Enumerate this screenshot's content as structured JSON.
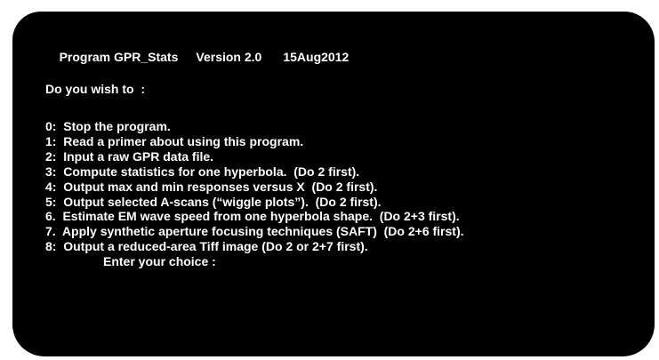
{
  "colors": {
    "background": "#000000",
    "text": "#ffffff",
    "page": "#ffffff"
  },
  "header": {
    "program": "Program GPR_Stats",
    "version": "Version 2.0",
    "date": "15Aug2012"
  },
  "prompt": "Do you wish to  :",
  "menu": {
    "items": [
      "0:  Stop the program.",
      "1:  Read a primer about using this program.",
      "2:  Input a raw GPR data file.",
      "3:  Compute statistics for one hyperbola.  (Do 2 first).",
      "4:  Output max and min responses versus X  (Do 2 first).",
      "5:  Output selected A-scans (“wiggle plots”).  (Do 2 first).",
      "6.  Estimate EM wave speed from one hyperbola shape.  (Do 2+3 first).",
      "7.  Apply synthetic aperture focusing techniques (SAFT)  (Do 2+6 first).",
      "8:  Output a reduced-area Tiff image (Do 2 or 2+7 first)."
    ]
  },
  "choice_prompt": "Enter your choice :"
}
